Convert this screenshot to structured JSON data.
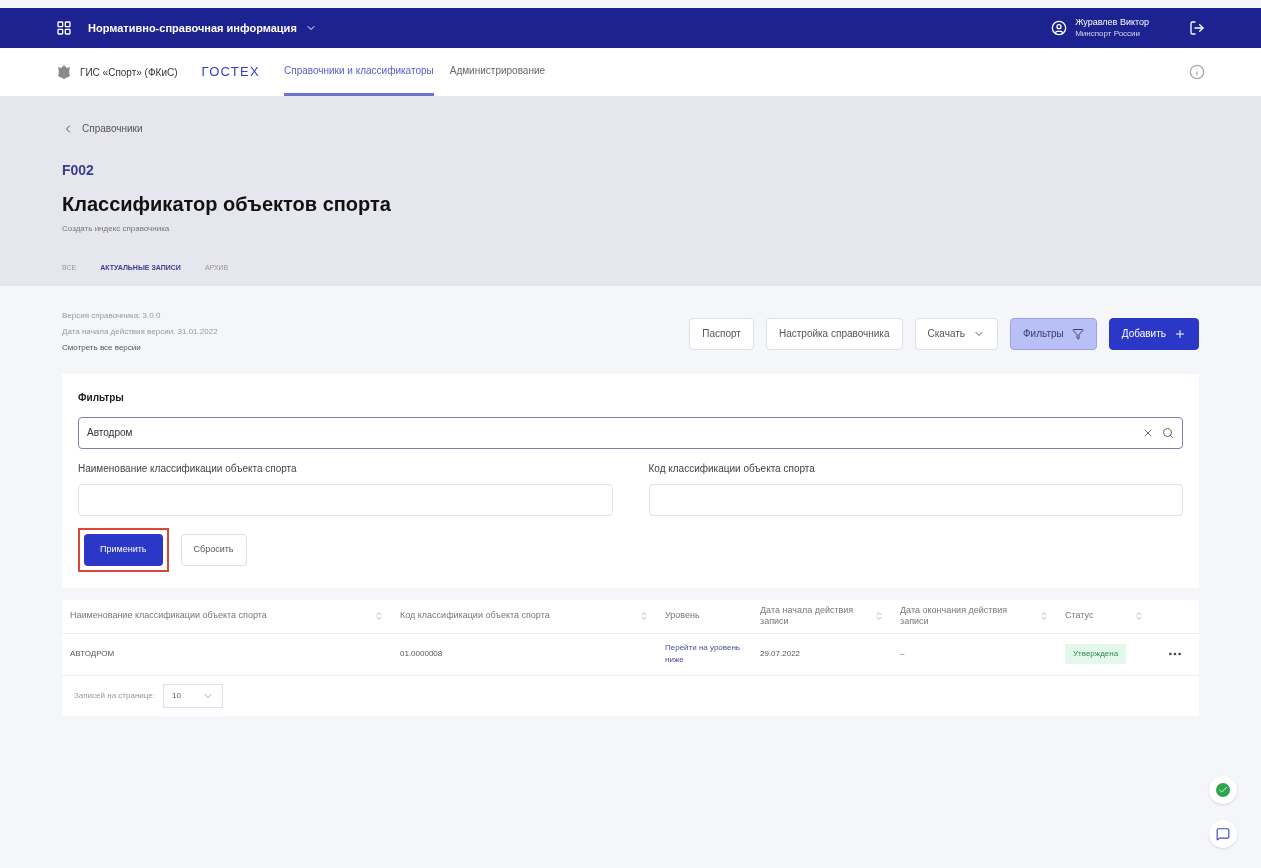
{
  "top_bar": {
    "app_name": "Нормативно-справочная информация",
    "user_name": "Журавлев Виктор",
    "user_org": "Минспорт России"
  },
  "nav": {
    "org": "ГИС «Спорт» (ФКиС)",
    "brand": "ГОСТЕХ",
    "items": [
      {
        "label": "Справочники и классификаторы",
        "selected": true
      },
      {
        "label": "Администрирование",
        "selected": false
      }
    ]
  },
  "header": {
    "back": "Справочники",
    "code": "F002",
    "title": "Классификатор объектов спорта",
    "subtitle": "Создать индекс справочника",
    "tabs": [
      {
        "label": "ВСЕ",
        "selected": false
      },
      {
        "label": "АКТУАЛЬНЫЕ ЗАПИСИ",
        "selected": true
      },
      {
        "label": "АРХИВ",
        "selected": false
      }
    ]
  },
  "version": {
    "version": "Версия справочника: 3.0.0",
    "start": "Дата начала действия версии: 31.01.2022",
    "all_link": "Смотреть все версии"
  },
  "actions": [
    {
      "label": "Паспорт",
      "kind": "plain"
    },
    {
      "label": "Настройка справочника",
      "kind": "plain"
    },
    {
      "label": "Скачать",
      "kind": "dropdown"
    },
    {
      "label": "Фильтры",
      "kind": "filter"
    },
    {
      "label": "Добавить",
      "kind": "add"
    }
  ],
  "filters": {
    "title": "Фильтры",
    "search_value": "Автодром",
    "fields": [
      {
        "label": "Наименование классификации объекта спорта"
      },
      {
        "label": "Код классификации объекта спорта"
      }
    ],
    "apply": "Применить",
    "apply_highlighted": true,
    "reset": "Сбросить"
  },
  "table": {
    "columns": [
      {
        "label": "Наименование классификации объекта спорта",
        "sortable": true
      },
      {
        "label": "Код классификации объекта спорта",
        "sortable": true
      },
      {
        "label": "Уровень",
        "sortable": false
      },
      {
        "label": "Дата начала действия записи",
        "sortable": true
      },
      {
        "label": "Дата окончания действия записи",
        "sortable": true
      },
      {
        "label": "Статус",
        "sortable": true
      }
    ],
    "rows": [
      {
        "cells": [
          "АВТОДРОМ",
          "01.0000008",
          "Перейти на уровень ниже",
          "29.07.2022",
          "–",
          "Утверждена"
        ]
      }
    ],
    "page_size_label": "Записей на странице:",
    "page_size": "10"
  }
}
